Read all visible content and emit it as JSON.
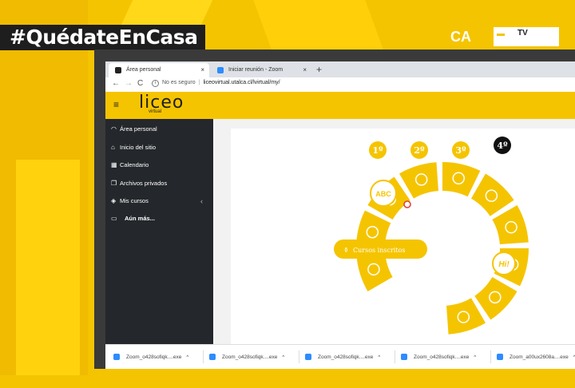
{
  "overlay": {
    "hashtag": "#QuédateEnCasa",
    "channel_prefix": "CA",
    "channel_suffix": "TV"
  },
  "browser": {
    "tabs": [
      {
        "label": "Área personal",
        "close": "×",
        "color": "#222222"
      },
      {
        "label": "Iniciar reunión - Zoom",
        "close": "×",
        "color": "#2d8cff"
      }
    ],
    "new_tab": "+",
    "nav": {
      "back": "←",
      "forward": "→",
      "reload": "C"
    },
    "address": {
      "info": "i",
      "security": "No es seguro",
      "separator": "|",
      "url": "liceovirtual.utalca.cl/lvirtual/my/"
    }
  },
  "site": {
    "menu_icon": "≡",
    "logo": "liceo",
    "logo_sub": "virtual",
    "sidebar": [
      {
        "icon": "gauge-icon",
        "glyph": "◠",
        "label": "Área personal"
      },
      {
        "icon": "home-icon",
        "glyph": "⌂",
        "label": "Inicio del sitio"
      },
      {
        "icon": "calendar-icon",
        "glyph": "▦",
        "label": "Calendario"
      },
      {
        "icon": "file-icon",
        "glyph": "❐",
        "label": "Archivos privados"
      },
      {
        "icon": "graduation-cap-icon",
        "glyph": "◈",
        "label": "Mis cursos"
      },
      {
        "icon": "folder-icon",
        "glyph": "▭",
        "label": "Aún más..."
      }
    ],
    "sidebar_chevron": "‹",
    "wheel": {
      "grades": [
        "1º",
        "2º",
        "3º",
        "4º"
      ],
      "center_button": "Cursos inscritos",
      "bubble_abc": "ABC",
      "bubble_hi": "Hi!"
    }
  },
  "downloads": [
    {
      "name": "Zoom_o428sofiqk....exe",
      "caret": "^"
    },
    {
      "name": "Zoom_o428sofiqk....exe",
      "caret": "^"
    },
    {
      "name": "Zoom_o428sofiqk....exe",
      "caret": "^"
    },
    {
      "name": "Zoom_o428sofiqk....exe",
      "caret": "^"
    },
    {
      "name": "Zoom_a00ux2608a....exe",
      "caret": "^"
    }
  ],
  "colors": {
    "brand_yellow": "#f5c400",
    "dark": "#1e1e1e",
    "sidebar": "#24272b",
    "zoom_blue": "#2d8cff"
  }
}
